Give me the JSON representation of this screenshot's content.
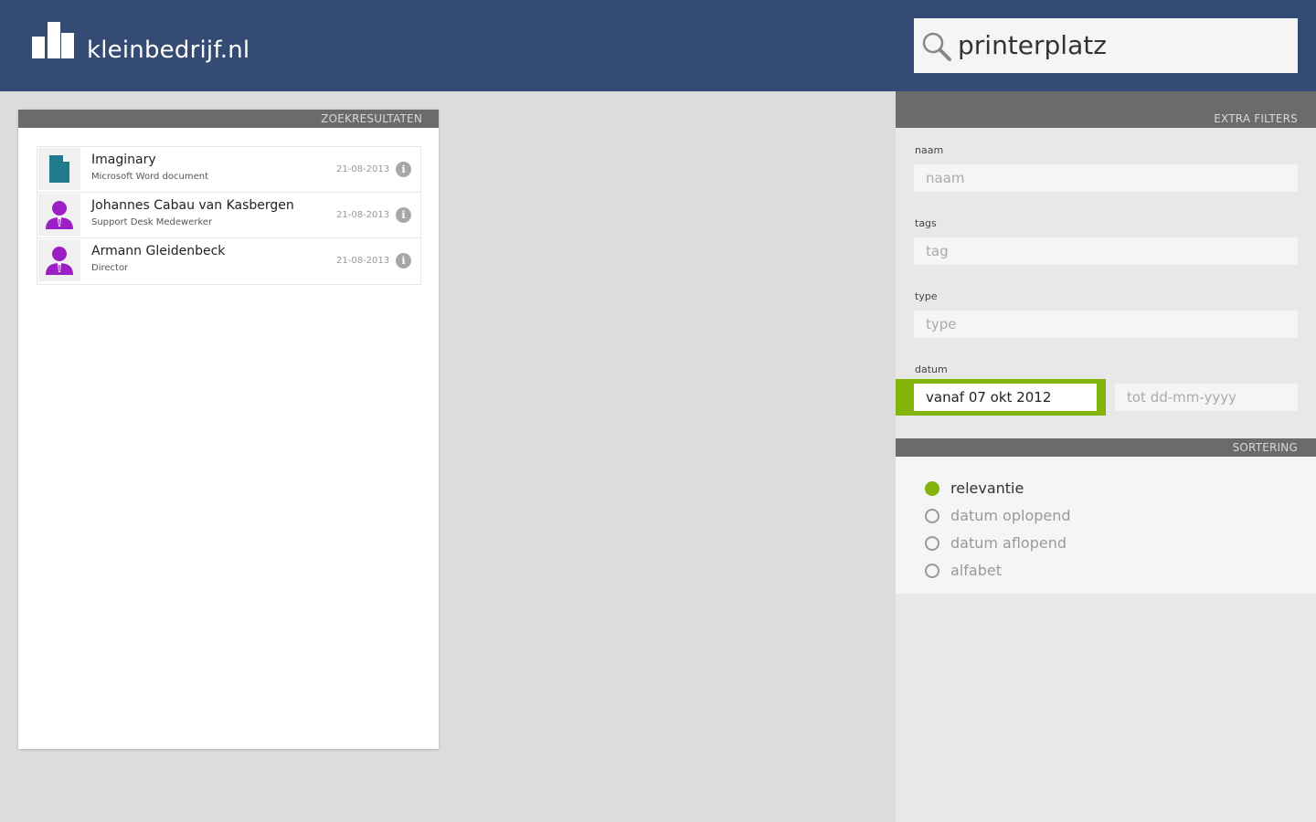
{
  "header": {
    "brand": "kleinbedrijf.nl",
    "search_value": "printerplatz",
    "background_color": "#344c74"
  },
  "results": {
    "title": "ZOEKRESULTATEN",
    "items": [
      {
        "title": "Imaginary",
        "subtitle": "Microsoft Word document",
        "date": "21-08-2013",
        "icon": "document-icon"
      },
      {
        "title": "Johannes Cabau van Kasbergen",
        "subtitle": "Support Desk Medewerker",
        "date": "21-08-2013",
        "icon": "person-icon"
      },
      {
        "title": "Armann Gleidenbeck",
        "subtitle": "Director",
        "date": "21-08-2013",
        "icon": "person-icon"
      }
    ],
    "info_glyph": "i"
  },
  "filters": {
    "title": "EXTRA FILTERS",
    "naam": {
      "label": "naam",
      "placeholder": "naam"
    },
    "tags": {
      "label": "tags",
      "placeholder": "tag"
    },
    "type": {
      "label": "type",
      "placeholder": "type"
    },
    "datum": {
      "label": "datum",
      "from_value": "vanaf 07 okt 2012",
      "to_placeholder": "tot dd-mm-yyyy"
    }
  },
  "sorting": {
    "title": "SORTERING",
    "options": [
      {
        "label": "relevantie",
        "selected": true
      },
      {
        "label": "datum oplopend",
        "selected": false
      },
      {
        "label": "datum aflopend",
        "selected": false
      },
      {
        "label": "alfabet",
        "selected": false
      }
    ]
  },
  "colors": {
    "accent": "#82b40a",
    "document": "#1f7a8c",
    "person": "#9b1fc4",
    "section_header": "#6b6b6b"
  }
}
